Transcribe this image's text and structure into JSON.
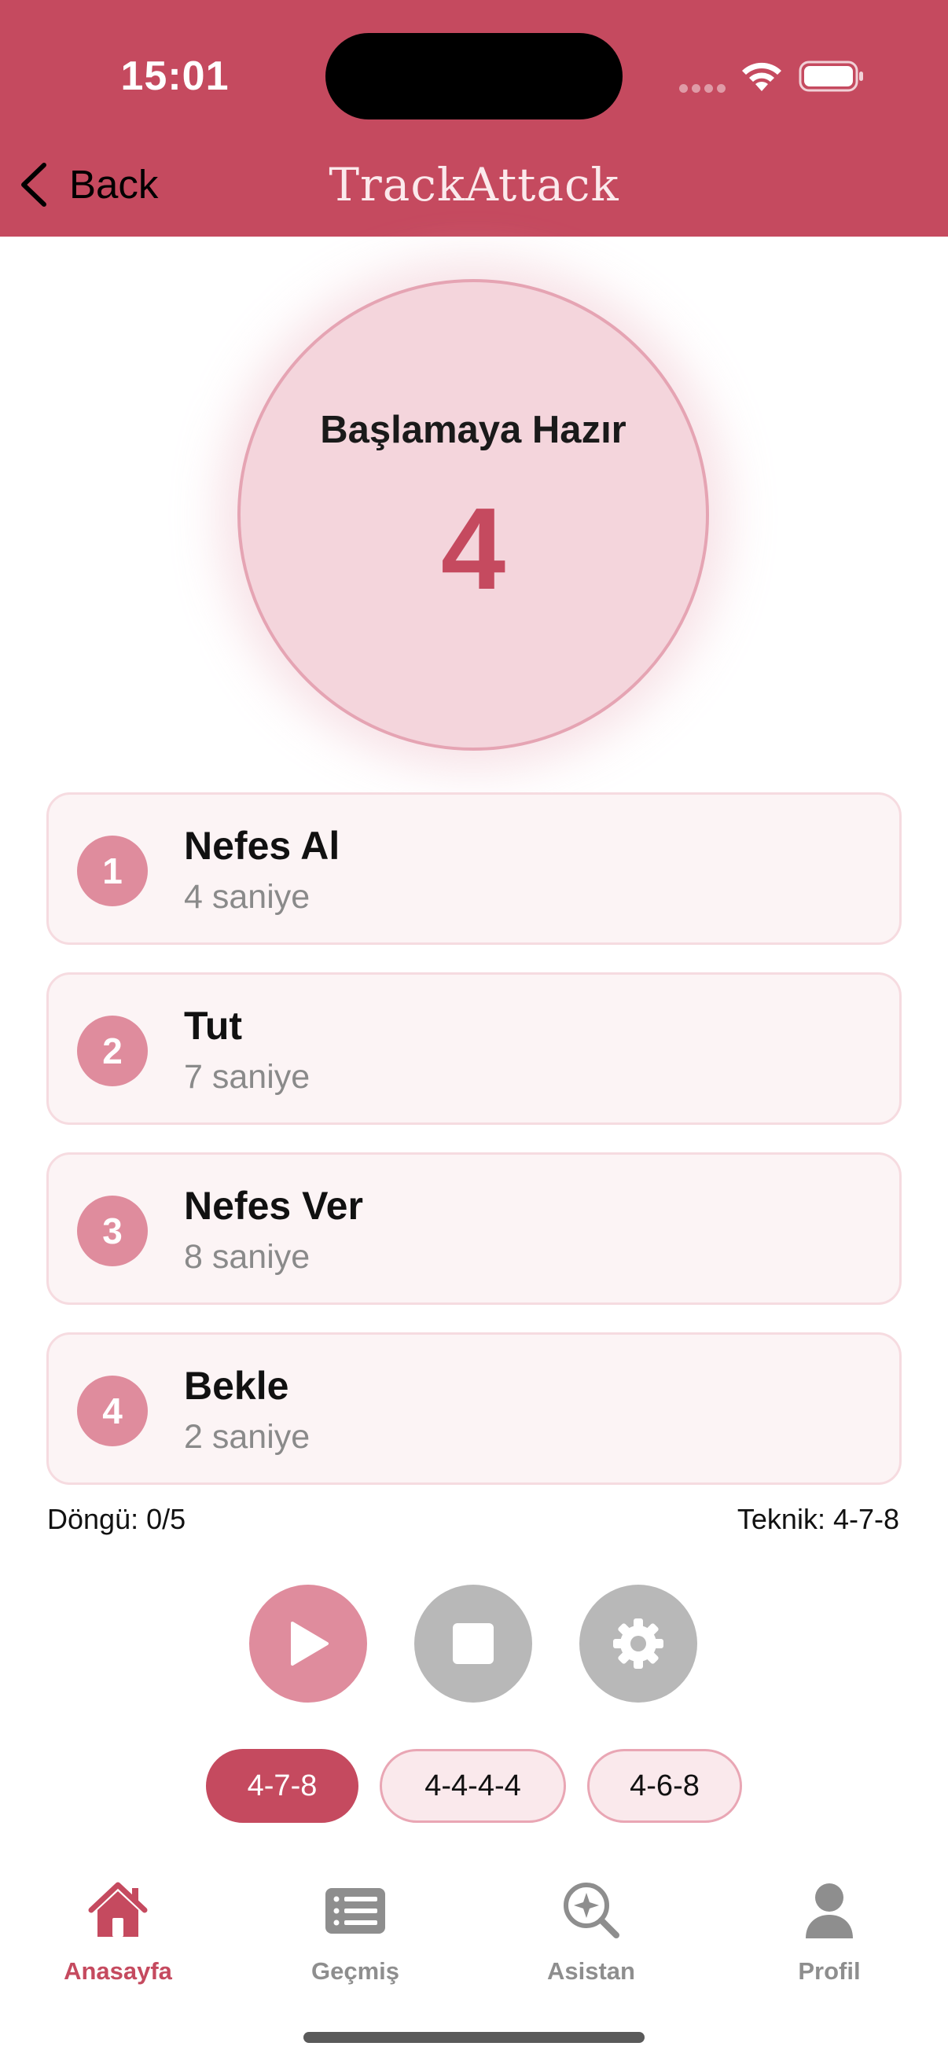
{
  "status_bar": {
    "time": "15:01",
    "icons": [
      "signal-icon",
      "wifi-icon",
      "battery-icon"
    ]
  },
  "nav": {
    "back_label": "Back",
    "title": "TrackAttack"
  },
  "breath": {
    "phase_label": "Başlamaya Hazır",
    "count": "4"
  },
  "steps": [
    {
      "number": "1",
      "title": "Nefes Al",
      "duration": "4 saniye"
    },
    {
      "number": "2",
      "title": "Tut",
      "duration": "7 saniye"
    },
    {
      "number": "3",
      "title": "Nefes Ver",
      "duration": "8 saniye"
    },
    {
      "number": "4",
      "title": "Bekle",
      "duration": "2 saniye"
    }
  ],
  "session": {
    "cycle": "Döngü: 0/5",
    "technique": "Teknik: 4-7-8"
  },
  "controls": {
    "icons": [
      "play-icon",
      "stop-icon",
      "gear-icon"
    ]
  },
  "techniques": [
    {
      "label": "4-7-8",
      "selected": true
    },
    {
      "label": "4-4-4-4",
      "selected": false
    },
    {
      "label": "4-6-8",
      "selected": false
    }
  ],
  "tabs": [
    {
      "label": "Anasayfa",
      "icon": "home-icon",
      "active": true
    },
    {
      "label": "Geçmiş",
      "icon": "list-icon",
      "active": false
    },
    {
      "label": "Asistan",
      "icon": "sparkle-search-icon",
      "active": false
    },
    {
      "label": "Profil",
      "icon": "person-icon",
      "active": false
    }
  ],
  "colors": {
    "brand": "#c54a5f",
    "step_badge": "#df8c9d",
    "circle_fill": "#f4d5dc",
    "inactive_control": "#b8b8b8",
    "tab_inactive": "#8e8e8e"
  }
}
